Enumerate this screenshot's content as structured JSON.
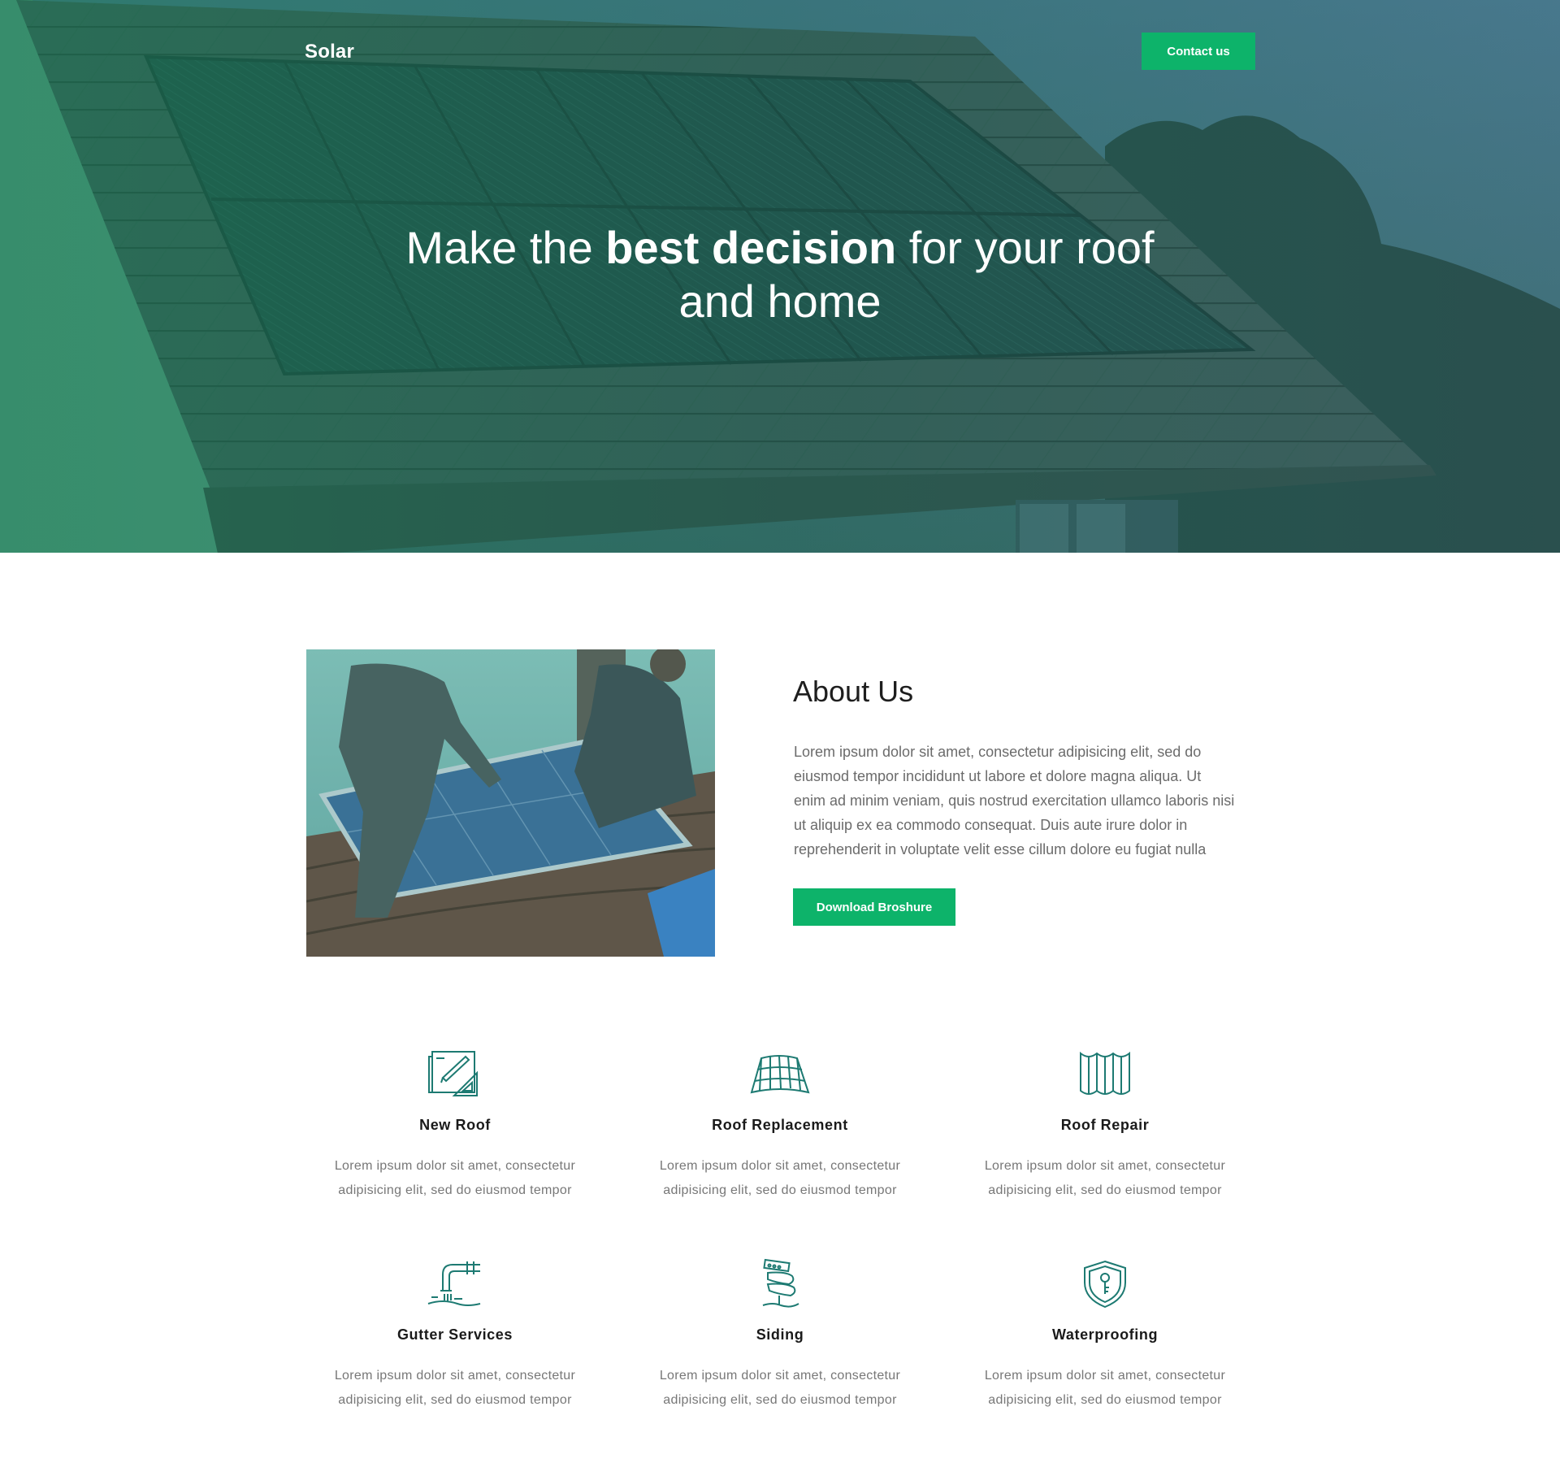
{
  "header": {
    "brand": "Solar",
    "contact_label": "Contact us"
  },
  "hero": {
    "title_pre": "Make the ",
    "title_bold": "best decision",
    "title_post": " for your roof",
    "title_line2": "and home"
  },
  "about": {
    "title": "About Us",
    "text": "Lorem ipsum dolor sit amet, consectetur adipisicing elit, sed do eiusmod tempor incididunt ut labore et dolore magna aliqua. Ut enim ad minim veniam, quis nostrud exercitation ullamco laboris nisi ut aliquip ex ea commodo consequat. Duis aute irure dolor in reprehenderit in voluptate velit esse cillum dolore eu fugiat nulla",
    "button_label": "Download Broshure"
  },
  "services": [
    {
      "title": "New Roof",
      "text": "Lorem ipsum dolor sit amet, consectetur adipisicing elit, sed do eiusmod tempor",
      "icon": "blueprint-icon"
    },
    {
      "title": "Roof Replacement",
      "text": "Lorem ipsum dolor sit amet, consectetur adipisicing elit, sed do eiusmod tempor",
      "icon": "roof-tiles-icon"
    },
    {
      "title": "Roof Repair",
      "text": "Lorem ipsum dolor sit amet, consectetur adipisicing elit, sed do eiusmod tempor",
      "icon": "roof-sheet-icon"
    },
    {
      "title": "Gutter Services",
      "text": "Lorem ipsum dolor sit amet, consectetur adipisicing elit, sed do eiusmod tempor",
      "icon": "gutter-pipe-icon"
    },
    {
      "title": "Siding",
      "text": "Lorem ipsum dolor sit amet, consectetur adipisicing elit, sed do eiusmod tempor",
      "icon": "siding-panels-icon"
    },
    {
      "title": "Waterproofing",
      "text": "Lorem ipsum dolor sit amet, consectetur adipisicing elit, sed do eiusmod tempor",
      "icon": "shield-key-icon"
    }
  ],
  "colors": {
    "accent": "#0db36a",
    "icon_stroke": "#1d7a72",
    "hero_overlay": "#1f7a5a"
  }
}
